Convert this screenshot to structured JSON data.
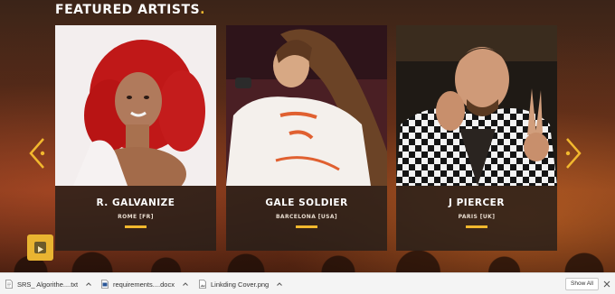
{
  "section": {
    "title": "FEATURED ARTISTS",
    "title_dot": "."
  },
  "artists": [
    {
      "name": "R. GALVANIZE",
      "location": "ROME [FR]"
    },
    {
      "name": "GALE SOLDIER",
      "location": "BARCELONA [USA]"
    },
    {
      "name": "J PIERCER",
      "location": "PARIS [UK]"
    }
  ],
  "controls": {
    "prev_icon": "chevron-left-icon",
    "next_icon": "chevron-right-icon",
    "play_icon": "play-icon"
  },
  "downloads": {
    "items": [
      {
        "name": "SRS_ Algorithe....txt",
        "icon": "text-file-icon"
      },
      {
        "name": "requirements....docx",
        "icon": "word-doc-icon"
      },
      {
        "name": "Linkding Cover.png",
        "icon": "image-file-icon"
      }
    ],
    "show_all_label": "Show All"
  },
  "colors": {
    "accent": "#f2b82e",
    "card_bg": "#261e1a"
  }
}
